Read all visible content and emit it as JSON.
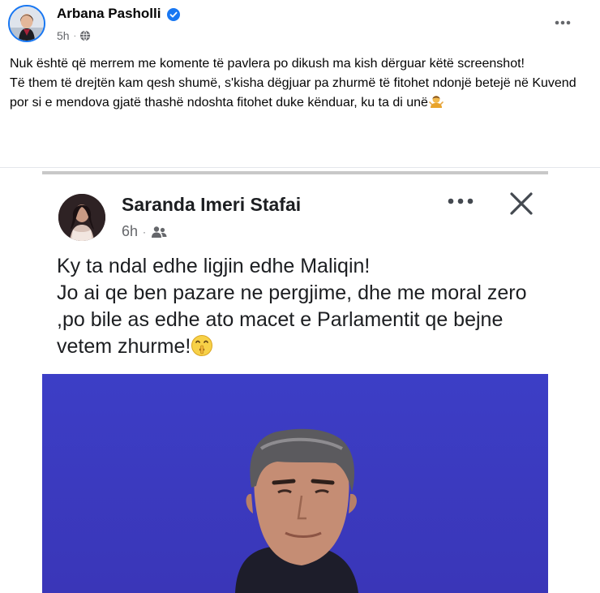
{
  "post": {
    "author": "Arbana Pasholli",
    "time": "5h",
    "paragraphs": [
      "Nuk është që merrem me komente të pavlera po dikush ma kish dërguar këtë screenshot!",
      "Të them të drejtën kam qesh shumë, s'kisha dëgjuar pa zhurmë të fitohet ndonjë betejë në Kuvend por si e mendova gjatë thashë ndoshta fitohet duke kënduar, ku ta di unë"
    ],
    "icons": {
      "verified": "verified-badge-icon",
      "audience": "globe-icon",
      "more": "more-options-icon",
      "emoji": "person-shrugging-emoji"
    },
    "colors": {
      "accent": "#1877f2",
      "meta": "#65676b",
      "text": "#050505"
    }
  },
  "screenshot": {
    "author": "Saranda Imeri Stafai",
    "time": "6h",
    "lines": [
      "Ky ta ndal edhe ligjin edhe Maliqin!",
      "Jo ai qe ben pazare ne pergjime, dhe me moral zero ,po bile as edhe ato macet e Parlamentit qe bejne vetem zhurme!"
    ],
    "icons": {
      "audience": "friends-icon",
      "more": "more-options-icon",
      "close": "close-icon",
      "emoji": "shushing-face-emoji"
    },
    "photo_background": "#3b3ec2"
  }
}
